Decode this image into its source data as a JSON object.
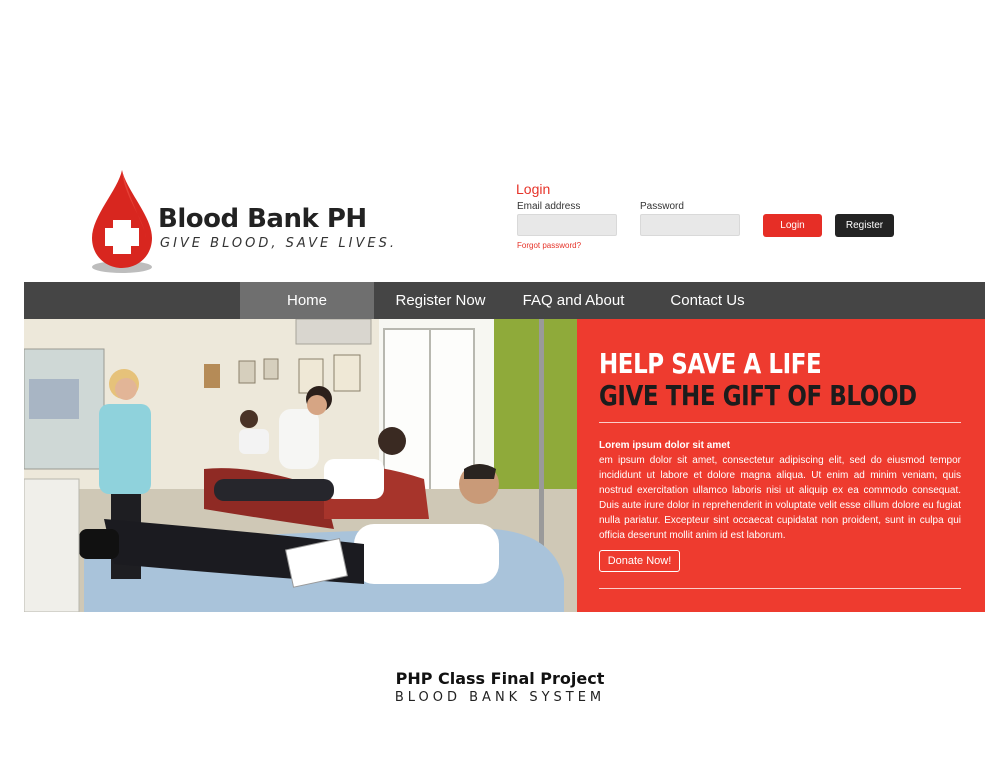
{
  "logo": {
    "title": "Blood Bank PH",
    "tagline": "GIVE BLOOD, SAVE LIVES."
  },
  "login": {
    "title": "Login",
    "email_label": "Email address",
    "email_value": "",
    "password_label": "Password",
    "password_value": "",
    "forgot_link": "Forgot password?",
    "login_button": "Login",
    "register_button": "Register"
  },
  "nav": {
    "items": [
      {
        "label": "Home",
        "active": true
      },
      {
        "label": "Register Now",
        "active": false
      },
      {
        "label": "FAQ and About",
        "active": false
      },
      {
        "label": "Contact Us",
        "active": false
      }
    ]
  },
  "hero": {
    "line1": "HELP SAVE A LIFE",
    "line2": "GIVE THE GIFT OF BLOOD",
    "heading": "Lorem ipsum dolor sit amet",
    "body": "em ipsum dolor sit amet, consectetur adipiscing elit, sed do eiusmod tempor incididunt ut labore et dolore magna aliqua. Ut enim ad minim veniam, quis nostrud exercitation ullamco laboris nisi ut aliquip ex ea commodo consequat. Duis aute irure dolor in reprehenderit in voluptate velit esse cillum dolore eu fugiat nulla pariatur. Excepteur sint occaecat cupidatat non proident, sunt in culpa qui officia deserunt mollit anim id est laborum.",
    "donate_button": "Donate Now!"
  },
  "caption": {
    "title": "PHP Class Final Project",
    "subtitle": "BLOOD BANK SYSTEM"
  },
  "colors": {
    "accent_red": "#ee3b2f",
    "nav_bg": "#454545",
    "nav_active": "#6f6f6f",
    "register_button": "#232323"
  }
}
